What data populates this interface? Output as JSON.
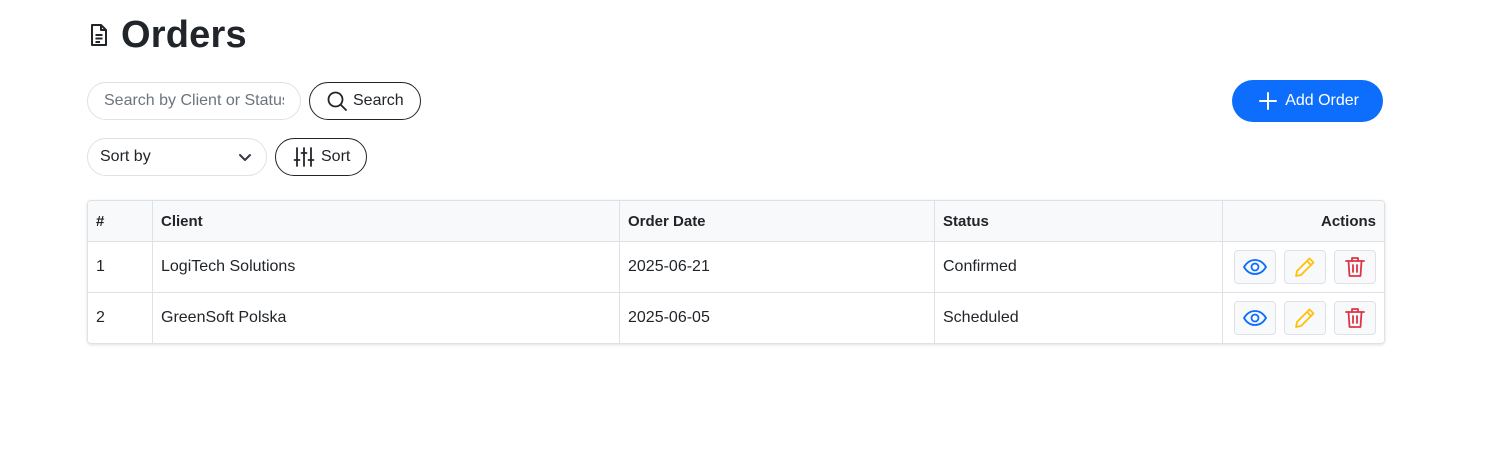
{
  "header": {
    "title": "Orders",
    "title_icon": "document-icon"
  },
  "search": {
    "placeholder": "Search by Client or Status",
    "value": "",
    "button_label": "Search",
    "button_icon": "search-icon"
  },
  "add_order": {
    "label": "Add Order",
    "icon": "plus-icon",
    "color": "#0d6efd"
  },
  "sort": {
    "select_value": "Sort by",
    "button_label": "Sort",
    "button_icon": "sliders-icon"
  },
  "table": {
    "columns": [
      "#",
      "Client",
      "Order Date",
      "Status",
      "Actions"
    ],
    "rows": [
      {
        "num": "1",
        "client": "LogiTech Solutions",
        "date": "2025-06-21",
        "status": "Confirmed"
      },
      {
        "num": "2",
        "client": "GreenSoft Polska",
        "date": "2025-06-05",
        "status": "Scheduled"
      }
    ],
    "action_icons": {
      "view": "eye-icon",
      "edit": "pencil-icon",
      "delete": "trash-icon"
    },
    "action_colors": {
      "view": "#0d6efd",
      "edit": "#ffc107",
      "delete": "#dc3545"
    }
  }
}
